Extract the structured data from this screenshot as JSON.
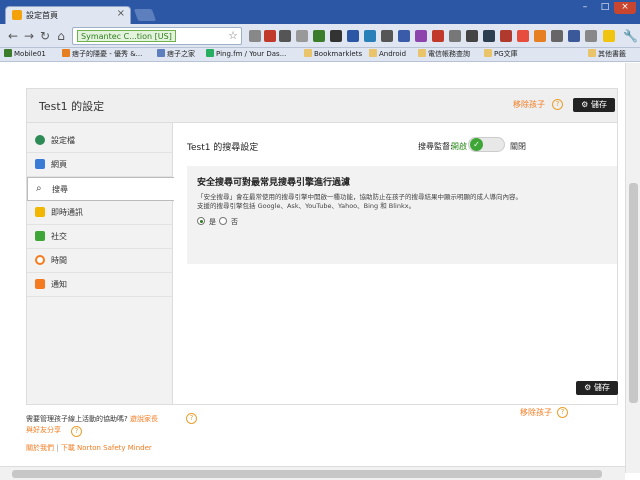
{
  "browser": {
    "tab_title": "設定首頁",
    "url_secure_label": "Symantec C...tion [US]",
    "bookmarks": [
      "Mobile01",
      "痞子的隱憂 - 優秀 &...",
      "痞子之家",
      "Ping.fm / Your Das...",
      "Bookmarklets",
      "Android",
      "電信帳務查詢",
      "PG文庫",
      "其他書籤"
    ]
  },
  "panel": {
    "title": "Test1 的設定",
    "remove_child": "移除孩子",
    "save": "儲存"
  },
  "sidebar": {
    "items": [
      {
        "label": "設定檔"
      },
      {
        "label": "網頁"
      },
      {
        "label": "搜尋"
      },
      {
        "label": "即時通訊"
      },
      {
        "label": "社交"
      },
      {
        "label": "時間"
      },
      {
        "label": "通知"
      }
    ]
  },
  "content": {
    "title": "Test1 的搜尋設定",
    "monitoring_label": "搜尋監督:",
    "on_label": "開啟",
    "off_label": "關閉",
    "setting_heading": "安全搜尋可對最常見搜尋引擎進行過濾",
    "setting_desc1": "「安全搜尋」會在最常使用的搜尋引擎中開啟一種功能，協助防止在孩子的搜尋結果中顯示明顯的成人導向內容。",
    "setting_desc2": "支援的搜尋引擎包括 Google、Ask、YouTube、Yahoo、Bing 和 Blinkx。",
    "option_yes": "是",
    "option_no": "否"
  },
  "footer": {
    "question": "需要管理孩子線上活動的協助嗎?",
    "guide_link": "遊說家長",
    "share_link": "與好友分享",
    "about_link": "關於我們",
    "separator": "|",
    "download_link": "下載 Norton Safety Minder"
  },
  "colors": {
    "accent": "#f47b20",
    "toggle_on": "#3ea636",
    "chrome_blue": "#2b57a5"
  }
}
